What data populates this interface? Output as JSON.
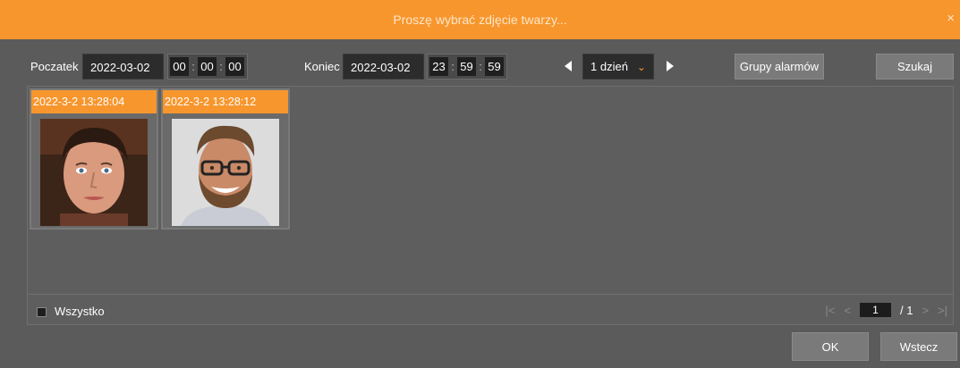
{
  "window": {
    "title": "Proszę wybrać zdjęcie twarzy...",
    "close_icon": "×"
  },
  "filter": {
    "start_label": "Poczatek",
    "start_date": "2022-03-02",
    "start_time": {
      "h": "00",
      "m": "00",
      "s": "00"
    },
    "end_label": "Koniec",
    "end_date": "2022-03-02",
    "end_time": {
      "h": "23",
      "m": "59",
      "s": "59"
    },
    "period": "1 dzień",
    "alarm_groups_label": "Grupy alarmów",
    "search_label": "Szukaj"
  },
  "photos": [
    {
      "timestamp": "2022-3-2 13:28:04",
      "icon": "face-photo-young-man"
    },
    {
      "timestamp": "2022-3-2 13:28:12",
      "icon": "face-photo-bearded-man"
    }
  ],
  "footer": {
    "select_all_label": "Wszystko",
    "page_current": "1",
    "page_total": "/ 1"
  },
  "actions": {
    "ok_label": "OK",
    "back_label": "Wstecz"
  },
  "colors": {
    "accent": "#f7962d",
    "background": "#5b5b5b"
  }
}
